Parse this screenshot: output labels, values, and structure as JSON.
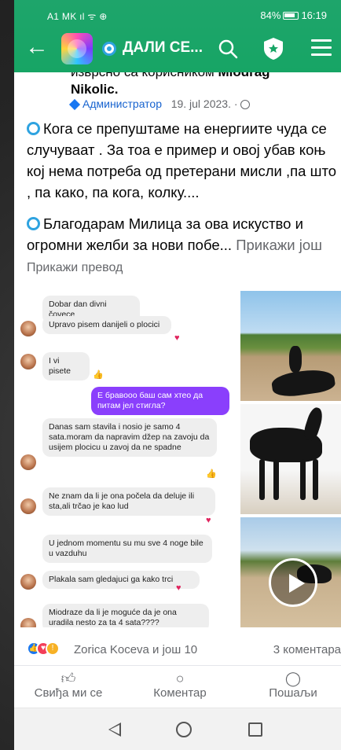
{
  "status": {
    "carrier": "A1 MK",
    "battery": "84%",
    "time": "16:19"
  },
  "header": {
    "title": "ДАЛИ СЕ...",
    "icons": [
      "back-icon",
      "group-avatar",
      "swirl-icon",
      "search-icon",
      "shield-icon",
      "menu-icon"
    ]
  },
  "post": {
    "author_prefix": "изврсно са корисником",
    "author_name_first": "Miodrag",
    "author_name_last": "Nikolic.",
    "role": "Администратор",
    "date": "19. jul 2023. ·",
    "paragraph1": "Кога се препуштаме на енергиите чуда се случуваат . За тоа е пример и овој убав коњ кој нема потреба од претерани мисли ,па што , па како, па кога, колку....",
    "paragraph2": "Благодарам Милица за ова искуство и огромни желби за нови побе...",
    "see_more": "Прикажи још",
    "see_translation": "Прикажи превод"
  },
  "chat": {
    "messages": [
      {
        "text": "Dobar dan divni čovece",
        "dir": "in"
      },
      {
        "text": "Upravo pisem danijeli o plocici",
        "dir": "in"
      },
      {
        "text": "I vi pisete",
        "dir": "in"
      },
      {
        "text": "Е бравооо баш сам хтео да питам јел стигла?",
        "dir": "out"
      },
      {
        "text": "Danas sam stavila i nosio je samo 4 sata.moram da napravim džep na zavoju da usijem plocicu u zavoj da ne spadne",
        "dir": "in"
      },
      {
        "text": "Ne znam da li je ona počela da deluje ili sta,ali trčao je kao lud",
        "dir": "in"
      },
      {
        "text": "U jednom momentu su mu sve 4 noge bile u vazduhu",
        "dir": "in"
      },
      {
        "text": "Plakala sam gledajuci ga kako trci",
        "dir": "in"
      },
      {
        "text": "Miodraze da li je moguće da je ona uradila nesto za ta 4 sata????",
        "dir": "in"
      }
    ]
  },
  "reactions": {
    "text": "Zorica Koceva и још 10",
    "comments": "3 коментара"
  },
  "actions": {
    "like": "Свиђа ми се",
    "comment": "Коментар",
    "share": "Пошаљи"
  },
  "colors": {
    "header_green": "#17a565",
    "facebook_blue": "#1877f2",
    "outgoing_bubble": "#8a3ffc"
  }
}
